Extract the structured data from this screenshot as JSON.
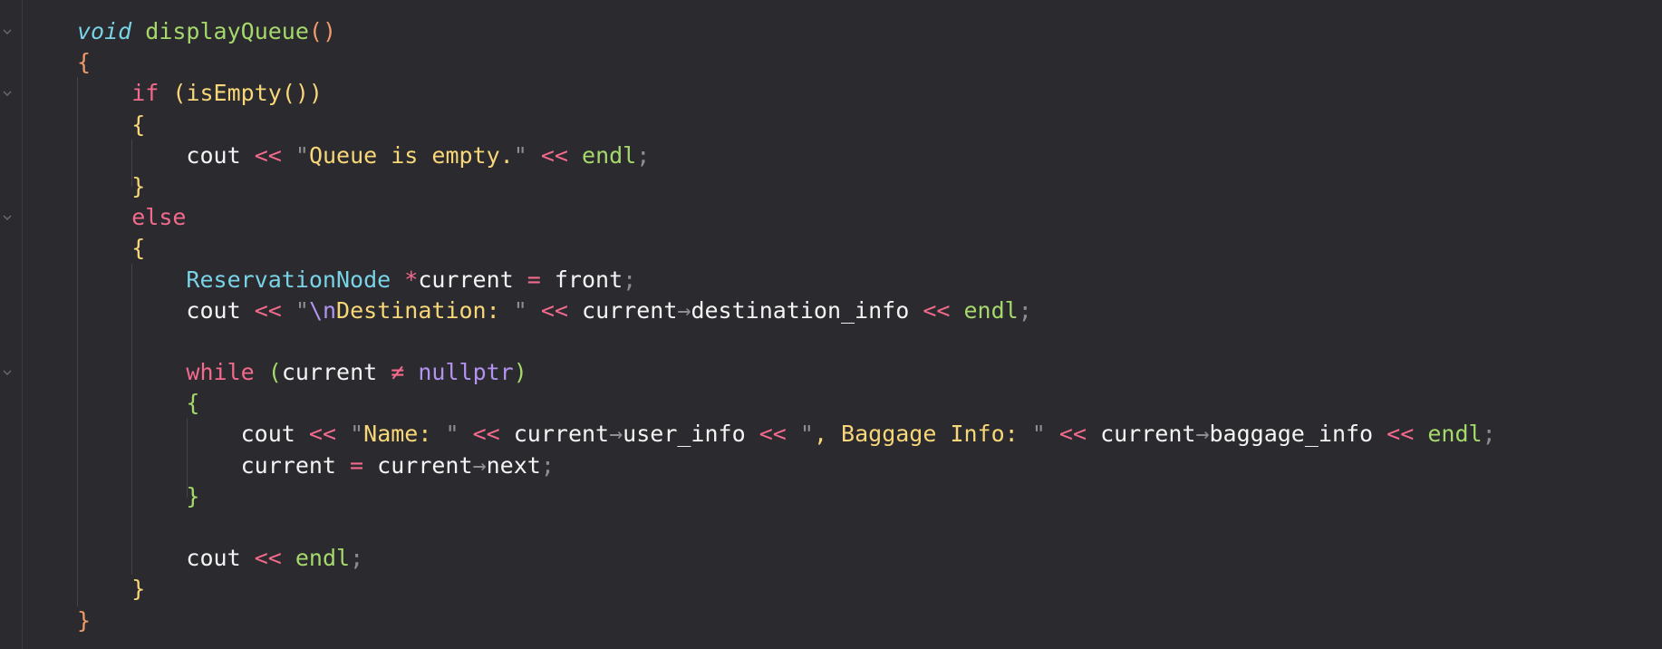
{
  "editor": {
    "code_lines": [
      [
        {
          "t": "void",
          "c": "ty-i"
        },
        {
          "t": " "
        },
        {
          "t": "displayQueue",
          "c": "fn"
        },
        {
          "t": "()",
          "c": "b-org"
        }
      ],
      [
        {
          "t": "{",
          "c": "b-org"
        }
      ],
      [
        {
          "t": "    "
        },
        {
          "t": "if",
          "c": "kw"
        },
        {
          "t": " "
        },
        {
          "t": "(",
          "c": "b-yel"
        },
        {
          "t": "isEmpty",
          "c": "b-yel"
        },
        {
          "t": "())",
          "c": "b-yel"
        }
      ],
      [
        {
          "t": "    "
        },
        {
          "t": "{",
          "c": "b-yel"
        }
      ],
      [
        {
          "t": "        "
        },
        {
          "t": "cout",
          "c": "plain"
        },
        {
          "t": " "
        },
        {
          "t": "<<",
          "c": "op"
        },
        {
          "t": " "
        },
        {
          "t": "\"",
          "c": "pun"
        },
        {
          "t": "Queue is empty.",
          "c": "str"
        },
        {
          "t": "\"",
          "c": "pun"
        },
        {
          "t": " "
        },
        {
          "t": "<<",
          "c": "op"
        },
        {
          "t": " "
        },
        {
          "t": "endl",
          "c": "fn"
        },
        {
          "t": ";",
          "c": "pun"
        }
      ],
      [
        {
          "t": "    "
        },
        {
          "t": "}",
          "c": "b-yel"
        }
      ],
      [
        {
          "t": "    "
        },
        {
          "t": "else",
          "c": "kw"
        }
      ],
      [
        {
          "t": "    "
        },
        {
          "t": "{",
          "c": "b-yel"
        }
      ],
      [
        {
          "t": "        "
        },
        {
          "t": "ReservationNode",
          "c": "ty"
        },
        {
          "t": " "
        },
        {
          "t": "*",
          "c": "op"
        },
        {
          "t": "current",
          "c": "plain"
        },
        {
          "t": " "
        },
        {
          "t": "=",
          "c": "op"
        },
        {
          "t": " "
        },
        {
          "t": "front",
          "c": "plain"
        },
        {
          "t": ";",
          "c": "pun"
        }
      ],
      [
        {
          "t": "        "
        },
        {
          "t": "cout",
          "c": "plain"
        },
        {
          "t": " "
        },
        {
          "t": "<<",
          "c": "op"
        },
        {
          "t": " "
        },
        {
          "t": "\"",
          "c": "pun"
        },
        {
          "t": "\\n",
          "c": "esc"
        },
        {
          "t": "Destination: ",
          "c": "str"
        },
        {
          "t": "\"",
          "c": "pun"
        },
        {
          "t": " "
        },
        {
          "t": "<<",
          "c": "op"
        },
        {
          "t": " "
        },
        {
          "t": "current",
          "c": "plain"
        },
        {
          "t": "→",
          "c": "pun"
        },
        {
          "t": "destination_info",
          "c": "plain"
        },
        {
          "t": " "
        },
        {
          "t": "<<",
          "c": "op"
        },
        {
          "t": " "
        },
        {
          "t": "endl",
          "c": "fn"
        },
        {
          "t": ";",
          "c": "pun"
        }
      ],
      [
        {
          "t": ""
        }
      ],
      [
        {
          "t": "        "
        },
        {
          "t": "while",
          "c": "kw"
        },
        {
          "t": " "
        },
        {
          "t": "(",
          "c": "b-grn"
        },
        {
          "t": "current",
          "c": "plain"
        },
        {
          "t": " "
        },
        {
          "t": "≠",
          "c": "op"
        },
        {
          "t": " "
        },
        {
          "t": "nullptr",
          "c": "nul"
        },
        {
          "t": ")",
          "c": "b-grn"
        }
      ],
      [
        {
          "t": "        "
        },
        {
          "t": "{",
          "c": "b-grn"
        }
      ],
      [
        {
          "t": "            "
        },
        {
          "t": "cout",
          "c": "plain"
        },
        {
          "t": " "
        },
        {
          "t": "<<",
          "c": "op"
        },
        {
          "t": " "
        },
        {
          "t": "\"",
          "c": "pun"
        },
        {
          "t": "Name: ",
          "c": "str"
        },
        {
          "t": "\"",
          "c": "pun"
        },
        {
          "t": " "
        },
        {
          "t": "<<",
          "c": "op"
        },
        {
          "t": " "
        },
        {
          "t": "current",
          "c": "plain"
        },
        {
          "t": "→",
          "c": "pun"
        },
        {
          "t": "user_info",
          "c": "plain"
        },
        {
          "t": " "
        },
        {
          "t": "<<",
          "c": "op"
        },
        {
          "t": " "
        },
        {
          "t": "\"",
          "c": "pun"
        },
        {
          "t": ", Baggage Info: ",
          "c": "str"
        },
        {
          "t": "\"",
          "c": "pun"
        },
        {
          "t": " "
        },
        {
          "t": "<<",
          "c": "op"
        },
        {
          "t": " "
        },
        {
          "t": "current",
          "c": "plain"
        },
        {
          "t": "→",
          "c": "pun"
        },
        {
          "t": "baggage_info",
          "c": "plain"
        },
        {
          "t": " "
        },
        {
          "t": "<<",
          "c": "op"
        },
        {
          "t": " "
        },
        {
          "t": "endl",
          "c": "fn"
        },
        {
          "t": ";",
          "c": "pun"
        }
      ],
      [
        {
          "t": "            "
        },
        {
          "t": "current",
          "c": "plain"
        },
        {
          "t": " "
        },
        {
          "t": "=",
          "c": "op"
        },
        {
          "t": " "
        },
        {
          "t": "current",
          "c": "plain"
        },
        {
          "t": "→",
          "c": "pun"
        },
        {
          "t": "next",
          "c": "plain"
        },
        {
          "t": ";",
          "c": "pun"
        }
      ],
      [
        {
          "t": "        "
        },
        {
          "t": "}",
          "c": "b-grn"
        }
      ],
      [
        {
          "t": ""
        }
      ],
      [
        {
          "t": "        "
        },
        {
          "t": "cout",
          "c": "plain"
        },
        {
          "t": " "
        },
        {
          "t": "<<",
          "c": "op"
        },
        {
          "t": " "
        },
        {
          "t": "endl",
          "c": "fn"
        },
        {
          "t": ";",
          "c": "pun"
        }
      ],
      [
        {
          "t": "    "
        },
        {
          "t": "}",
          "c": "b-yel"
        }
      ],
      [
        {
          "t": "}",
          "c": "b-org"
        }
      ]
    ],
    "fold_lines": [
      0,
      2,
      6,
      11
    ],
    "colors": {
      "background": "#2b2a2f",
      "keyword": "#f36a8c",
      "type": "#79d3e6",
      "function": "#a5d96b",
      "string": "#f8d779",
      "constant": "#b293ef",
      "text": "#f4f4f4"
    }
  }
}
